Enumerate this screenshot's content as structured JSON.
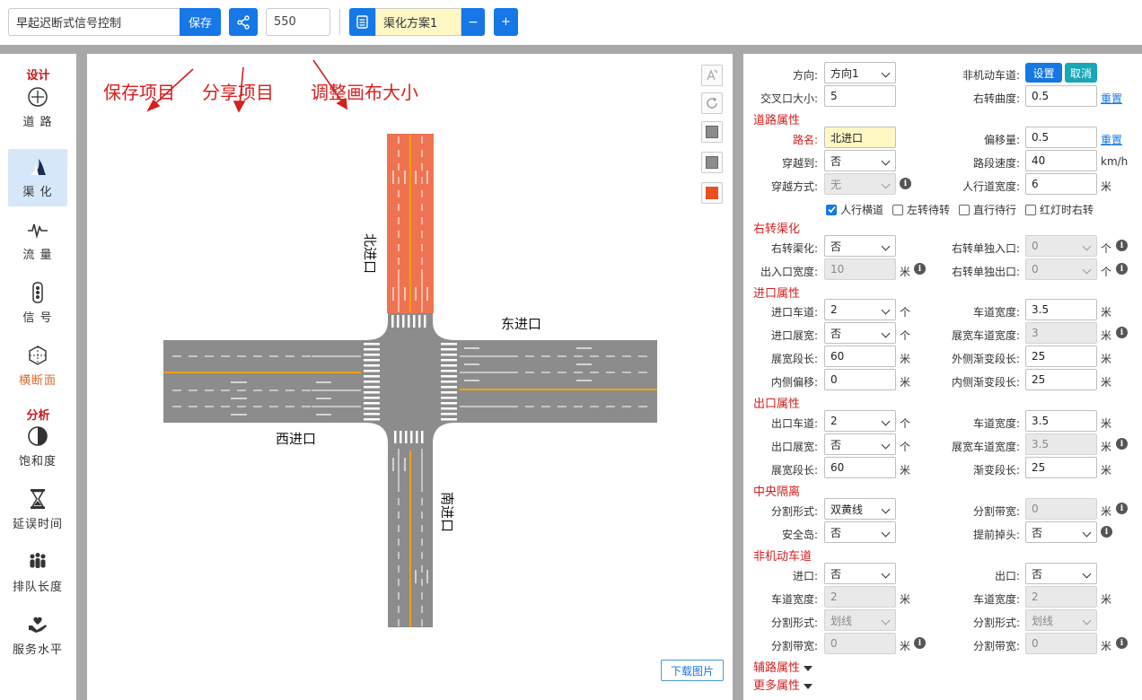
{
  "toolbar": {
    "project_name": "早起迟断式信号控制",
    "save_label": "保存",
    "canvas_size": "550",
    "plan_name": "渠化方案1",
    "minus_label": "−",
    "plus_label": "+"
  },
  "sidebar": {
    "section_design": "设计",
    "section_analysis": "分析",
    "items": [
      {
        "label": "道 路",
        "icon": "road-icon"
      },
      {
        "label": "渠 化",
        "icon": "channel-icon"
      },
      {
        "label": "流 量",
        "icon": "pulse-icon"
      },
      {
        "label": "信 号",
        "icon": "traffic-light-icon"
      },
      {
        "label": "横断面",
        "icon": "cross-section-icon"
      },
      {
        "label": "饱和度",
        "icon": "half-circle-icon"
      },
      {
        "label": "延误时间",
        "icon": "hourglass-icon"
      },
      {
        "label": "排队长度",
        "icon": "people-icon"
      },
      {
        "label": "服务水平",
        "icon": "heart-hand-icon"
      }
    ]
  },
  "annotations": {
    "save": "保存项目",
    "share": "分享项目",
    "resize": "调整画布大小"
  },
  "canvas": {
    "north": "北进口",
    "east": "东进口",
    "west": "西进口",
    "south": "南进口",
    "download_label": "下载图片",
    "colors": {
      "road": "#8c8c8c",
      "highlight": "#ef7351",
      "median": "#f0a000",
      "lane": "#ffffff",
      "active_tool": "#e8501d"
    }
  },
  "panel": {
    "direction": {
      "label": "方向:",
      "value": "方向1"
    },
    "nonmotor": {
      "label": "非机动车道:",
      "set": "设置",
      "cancel": "取消"
    },
    "junction_size": {
      "label": "交叉口大小:",
      "value": "5"
    },
    "right_curve": {
      "label": "右转曲度:",
      "value": "0.5",
      "reset": "重置"
    },
    "road_props": {
      "title": "道路属性",
      "name": {
        "label": "路名:",
        "value": "北进口"
      },
      "offset": {
        "label": "偏移量:",
        "value": "0.5",
        "reset": "重置"
      },
      "cross_to": {
        "label": "穿越到:",
        "value": "否"
      },
      "speed": {
        "label": "路段速度:",
        "value": "40",
        "unit": "km/h"
      },
      "cross_mode": {
        "label": "穿越方式:",
        "value": "无"
      },
      "sidewalk_width": {
        "label": "人行道宽度:",
        "value": "6",
        "unit": "米"
      },
      "checks": [
        "人行横道",
        "左转待转",
        "直行待行",
        "红灯时右转"
      ]
    },
    "right_channel": {
      "title": "右转渠化",
      "channel": {
        "label": "右转渠化:",
        "value": "否"
      },
      "single_in": {
        "label": "右转单独入口:",
        "value": "0",
        "unit": "个"
      },
      "io_width": {
        "label": "出入口宽度:",
        "value": "10",
        "unit": "米"
      },
      "single_out": {
        "label": "右转单独出口:",
        "value": "0",
        "unit": "个"
      }
    },
    "entry": {
      "title": "进口属性",
      "lanes": {
        "label": "进口车道:",
        "value": "2",
        "unit": "个"
      },
      "lane_width": {
        "label": "车道宽度:",
        "value": "3.5",
        "unit": "米"
      },
      "widen": {
        "label": "进口展宽:",
        "value": "否",
        "unit": "个"
      },
      "widen_width": {
        "label": "展宽车道宽度:",
        "value": "3",
        "unit": "米"
      },
      "widen_len": {
        "label": "展宽段长:",
        "value": "60",
        "unit": "米"
      },
      "outer_taper": {
        "label": "外侧渐变段长:",
        "value": "25",
        "unit": "米"
      },
      "inner_offset": {
        "label": "内侧偏移:",
        "value": "0",
        "unit": "米"
      },
      "inner_taper": {
        "label": "内侧渐变段长:",
        "value": "25",
        "unit": "米"
      }
    },
    "exit": {
      "title": "出口属性",
      "lanes": {
        "label": "出口车道:",
        "value": "2",
        "unit": "个"
      },
      "lane_width": {
        "label": "车道宽度:",
        "value": "3.5",
        "unit": "米"
      },
      "widen": {
        "label": "出口展宽:",
        "value": "否",
        "unit": "个"
      },
      "widen_width": {
        "label": "展宽车道宽度:",
        "value": "3.5",
        "unit": "米"
      },
      "widen_len": {
        "label": "展宽段长:",
        "value": "60",
        "unit": "米"
      },
      "taper": {
        "label": "渐变段长:",
        "value": "25",
        "unit": "米"
      }
    },
    "median": {
      "title": "中央隔离",
      "form": {
        "label": "分割形式:",
        "value": "双黄线"
      },
      "band_width": {
        "label": "分割带宽:",
        "value": "0",
        "unit": "米"
      },
      "island": {
        "label": "安全岛:",
        "value": "否"
      },
      "early_uturn": {
        "label": "提前掉头:",
        "value": "否"
      }
    },
    "nonmotor_lane": {
      "title": "非机动车道",
      "entry": {
        "label": "进口:",
        "value": "否"
      },
      "exit": {
        "label": "出口:",
        "value": "否"
      },
      "width_l": {
        "label": "车道宽度:",
        "value": "2",
        "unit": "米"
      },
      "width_r": {
        "label": "车道宽度:",
        "value": "2",
        "unit": "米"
      },
      "form_l": {
        "label": "分割形式:",
        "value": "划线"
      },
      "form_r": {
        "label": "分割形式:",
        "value": "划线"
      },
      "band_l": {
        "label": "分割带宽:",
        "value": "0",
        "unit": "米"
      },
      "band_r": {
        "label": "分割带宽:",
        "value": "0",
        "unit": "米"
      }
    },
    "aux": "辅路属性",
    "more": "更多属性"
  }
}
